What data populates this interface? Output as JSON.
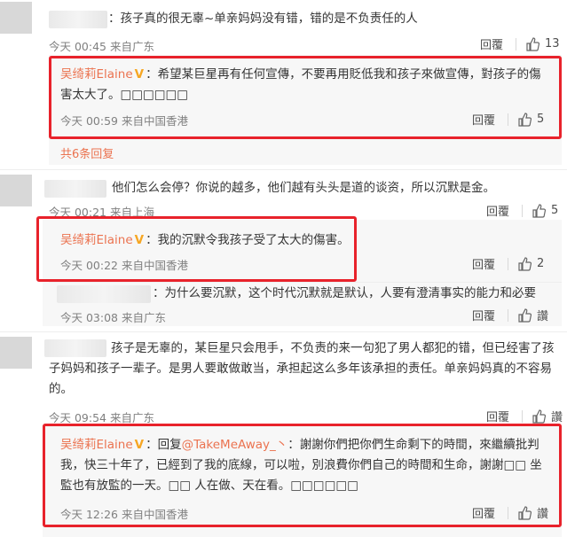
{
  "comments": [
    {
      "text": "：孩子真的很无辜~单亲妈妈没有错，错的是不负责任的人",
      "meta": "今天 00:45 来自广东",
      "reply_label": "回覆",
      "likes": "13",
      "replies": [
        {
          "author": "吴绮莉Elaine",
          "badge": "V",
          "text": "：希望某巨星再有任何宣傳，不要再用貶低我和孩子來做宣傳，對孩子的傷害太大了。□□□□□□",
          "meta": "今天 00:59 来自中国香港",
          "reply_label": "回覆",
          "likes": "5"
        }
      ],
      "more_label": "共6条回复"
    },
    {
      "text": "他们怎么会停？你说的越多，他们越有头头是道的谈资，所以沉默是金。",
      "meta": "今天 00:21 来自上海",
      "reply_label": "回覆",
      "likes": "5",
      "replies": [
        {
          "author": "吴绮莉Elaine",
          "badge": "V",
          "text": "：我的沉默令我孩子受了太大的傷害。",
          "meta": "今天 00:22 来自中国香港",
          "reply_label": "回覆",
          "likes": "2"
        },
        {
          "text": "：为什么要沉默，这个时代沉默就是默认，人要有澄清事实的能力和必要",
          "meta": "今天 03:08 来自广东",
          "reply_label": "回覆",
          "likes": "讚"
        }
      ]
    },
    {
      "text": "孩子是无辜的，某巨星只会甩手，不负责的来一句犯了男人都犯的错，但已经害了孩子妈妈和孩子一辈子。是男人要敢做敢当，承担起这么多年该承担的责任。单亲妈妈真的不容易的。",
      "meta": "今天 09:54 来自广东",
      "reply_label": "回覆",
      "likes": "讚",
      "replies": [
        {
          "author": "吴绮莉Elaine",
          "badge": "V",
          "reply_prefix": "：回复",
          "mention": "@TakeMeAway_丶",
          "text": "：謝謝你們把你們生命剩下的時間，來繼續批判我，快三十年了，已經到了我的底線，可以啦，別浪費你們自己的時間和生命，謝謝□□ 坐監也有放監的一天。□□ 人在做、天在看。□□□□□□",
          "meta": "今天 12:26 来自中国香港",
          "reply_label": "回覆",
          "likes": "讚"
        }
      ]
    }
  ]
}
